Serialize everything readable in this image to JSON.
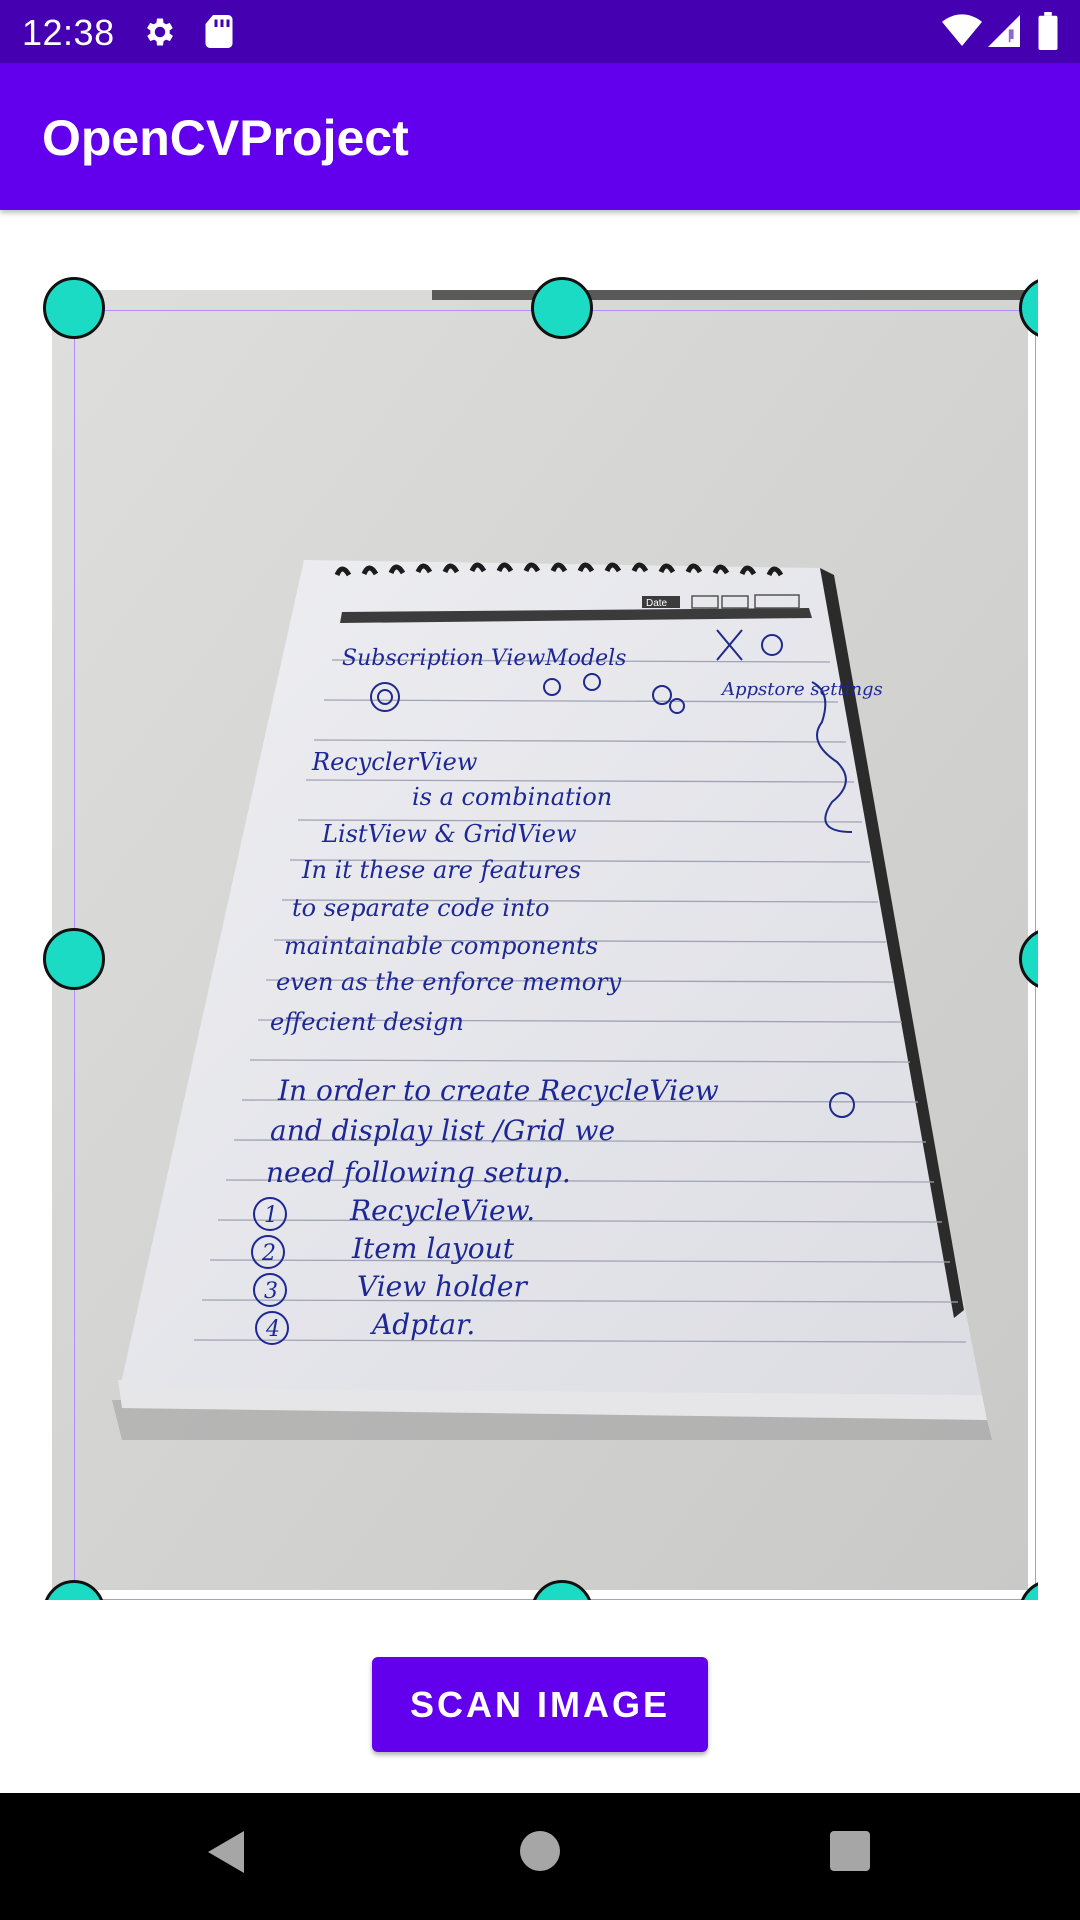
{
  "status_bar": {
    "time": "12:38",
    "icons": [
      "gear-icon",
      "sd-card-icon",
      "wifi-icon",
      "signal-icon",
      "battery-icon"
    ]
  },
  "app_bar": {
    "title": "OpenCVProject"
  },
  "document_photo": {
    "handwritten_lines": [
      "Subscription ViewModels",
      "Appstore settings",
      "RecyclerView",
      "is a combination",
      "ListView & GridView",
      "In it these are features",
      "to separate code into",
      "maintainable components",
      "even as the enforce memory",
      "effecient design",
      "In order to create RecycleView",
      "and display list /Grid we",
      "need following setup.",
      "RecycleView.",
      "Item layout",
      "View holder",
      "Adptar."
    ],
    "list_numbers": [
      "1",
      "2",
      "3",
      "4"
    ],
    "header_label": "Date"
  },
  "scan_button": {
    "label": "SCAN IMAGE"
  },
  "colors": {
    "status_bar": "#4500b2",
    "primary": "#6200ee",
    "handle": "#1cdbc4",
    "crop_line": "#b78cff"
  }
}
